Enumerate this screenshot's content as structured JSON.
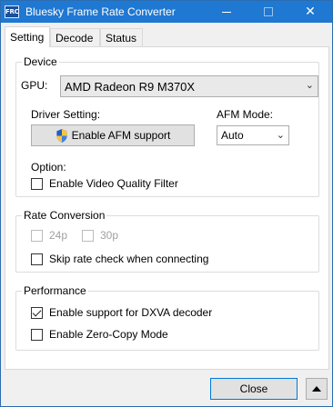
{
  "window": {
    "title": "Bluesky Frame Rate Converter",
    "app_icon_text": "FRC"
  },
  "tabs": [
    {
      "label": "Setting",
      "active": true
    },
    {
      "label": "Decode",
      "active": false
    },
    {
      "label": "Status",
      "active": false
    }
  ],
  "device": {
    "group_label": "Device",
    "gpu_label": "GPU:",
    "gpu_value": "AMD Radeon R9 M370X",
    "driver_label": "Driver Setting:",
    "afm_button": "Enable AFM support",
    "afm_mode_label": "AFM Mode:",
    "afm_mode_value": "Auto",
    "option_label": "Option:",
    "video_quality_filter": {
      "label": "Enable Video Quality Filter",
      "checked": false
    }
  },
  "rate_conversion": {
    "group_label": "Rate Conversion",
    "opt_24p": {
      "label": "24p",
      "checked": false,
      "disabled": true
    },
    "opt_30p": {
      "label": "30p",
      "checked": false,
      "disabled": true
    },
    "skip_rate_check": {
      "label": "Skip rate check when connecting",
      "checked": false
    }
  },
  "performance": {
    "group_label": "Performance",
    "dxva": {
      "label": "Enable support for DXVA decoder",
      "checked": true
    },
    "zero_copy": {
      "label": "Enable Zero-Copy Mode",
      "checked": false
    }
  },
  "footer": {
    "close_button": "Close"
  },
  "colors": {
    "titlebar": "#1f78d1",
    "accent_border": "#0078d7"
  },
  "icons": {
    "shield": "uac-shield-icon",
    "dropdown": "chevron-down-icon",
    "up": "triangle-up-icon"
  }
}
